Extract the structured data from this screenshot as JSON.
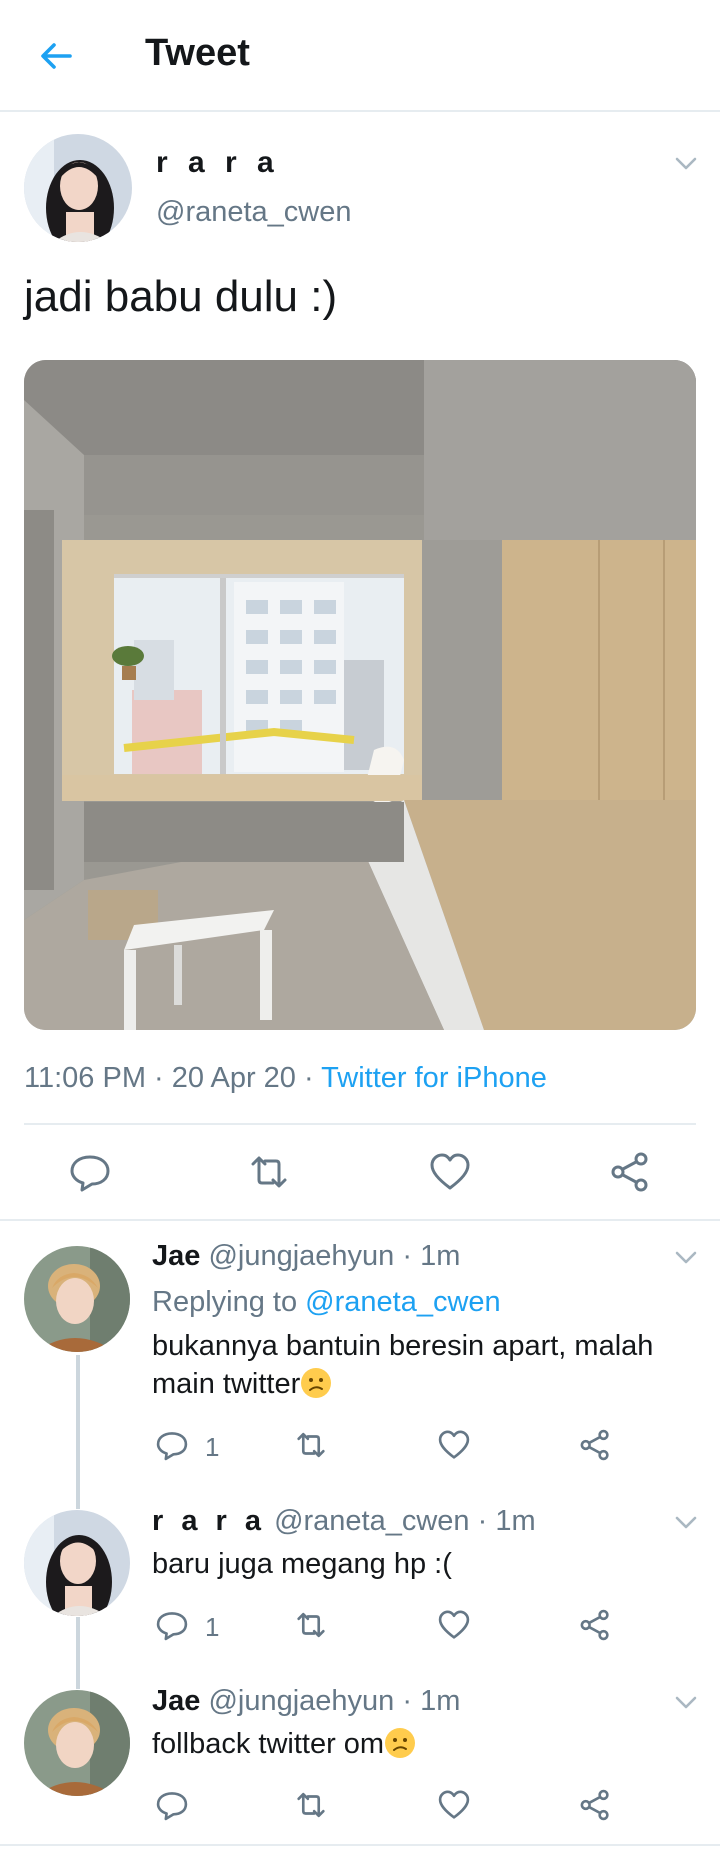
{
  "header": {
    "title": "Tweet"
  },
  "tweet": {
    "name": "r a r a",
    "handle": "@raneta_cwen",
    "text": "jadi babu dulu :)",
    "time": "11:06 PM",
    "sep1": " · ",
    "date": "20 Apr 20",
    "sep2": " · ",
    "source": "Twitter for iPhone"
  },
  "replies": [
    {
      "name": "Jae",
      "handle": "@jungjaehyun",
      "time": "1m",
      "replying_prefix": "Replying to ",
      "replying_to": "@raneta_cwen",
      "text_line1": "bukannya bantuin beresin apart, malah",
      "text_line2": "main twitter",
      "reply_count": "1"
    },
    {
      "name": "r a r a",
      "handle": "@raneta_cwen",
      "time": "1m",
      "text": "baru juga megang hp :(",
      "reply_count": "1"
    },
    {
      "name": "Jae",
      "handle": "@jungjaehyun",
      "time": "1m",
      "text": "follback twitter om"
    }
  ],
  "colors": {
    "accent": "#1da1f2",
    "secondary_text": "#657786",
    "divider": "#e6ecf0"
  },
  "icons": [
    "back-arrow-icon",
    "chevron-down-icon",
    "reply-icon",
    "retweet-icon",
    "like-icon",
    "share-icon",
    "confused-face-emoji"
  ]
}
